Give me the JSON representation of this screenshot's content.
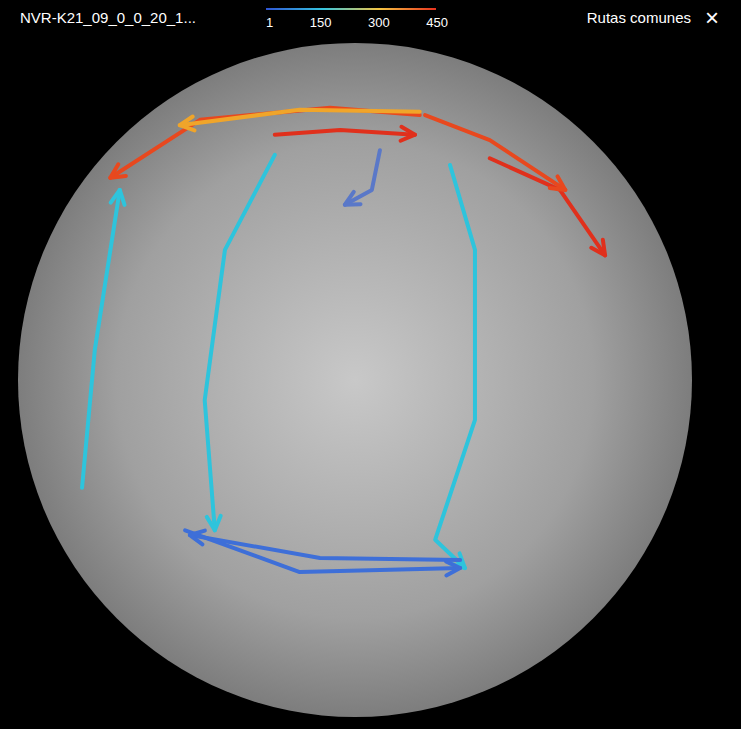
{
  "window": {
    "title": "NVR-K21_09_0_0_20_1...",
    "panel": "Rutas comunes",
    "close": "×"
  },
  "legend": {
    "ticks": [
      "1",
      "150",
      "300",
      "450"
    ]
  },
  "routes": [
    {
      "color": "#e8481e",
      "points": [
        [
          0.596,
          0.107
        ],
        [
          0.463,
          0.096
        ],
        [
          0.27,
          0.114
        ],
        [
          0.137,
          0.2
        ]
      ]
    },
    {
      "color": "#f0a52a",
      "points": [
        [
          0.596,
          0.102
        ],
        [
          0.418,
          0.099
        ],
        [
          0.24,
          0.122
        ]
      ]
    },
    {
      "color": "#e0301c",
      "points": [
        [
          0.381,
          0.136
        ],
        [
          0.478,
          0.129
        ],
        [
          0.589,
          0.136
        ]
      ]
    },
    {
      "color": "#e0301c",
      "points": [
        [
          0.7,
          0.171
        ],
        [
          0.804,
          0.218
        ],
        [
          0.871,
          0.315
        ]
      ]
    },
    {
      "color": "#e8481e",
      "points": [
        [
          0.604,
          0.107
        ],
        [
          0.7,
          0.144
        ],
        [
          0.812,
          0.218
        ]
      ]
    },
    {
      "color": "#2ec4dc",
      "points": [
        [
          0.095,
          0.66
        ],
        [
          0.114,
          0.455
        ],
        [
          0.151,
          0.218
        ]
      ]
    },
    {
      "color": "#2ec4dc",
      "points": [
        [
          0.381,
          0.166
        ],
        [
          0.307,
          0.307
        ],
        [
          0.277,
          0.53
        ],
        [
          0.292,
          0.723
        ]
      ]
    },
    {
      "color": "#2ec4dc",
      "points": [
        [
          0.641,
          0.181
        ],
        [
          0.678,
          0.307
        ],
        [
          0.678,
          0.559
        ],
        [
          0.619,
          0.737
        ],
        [
          0.663,
          0.779
        ]
      ]
    },
    {
      "color": "#3e6fd8",
      "points": [
        [
          0.248,
          0.723
        ],
        [
          0.418,
          0.785
        ],
        [
          0.656,
          0.779
        ]
      ]
    },
    {
      "color": "#3e6fd8",
      "points": [
        [
          0.656,
          0.767
        ],
        [
          0.448,
          0.764
        ],
        [
          0.255,
          0.73
        ]
      ]
    },
    {
      "color": "#5a78c8",
      "points": [
        [
          0.537,
          0.159
        ],
        [
          0.525,
          0.218
        ],
        [
          0.485,
          0.24
        ]
      ]
    }
  ]
}
